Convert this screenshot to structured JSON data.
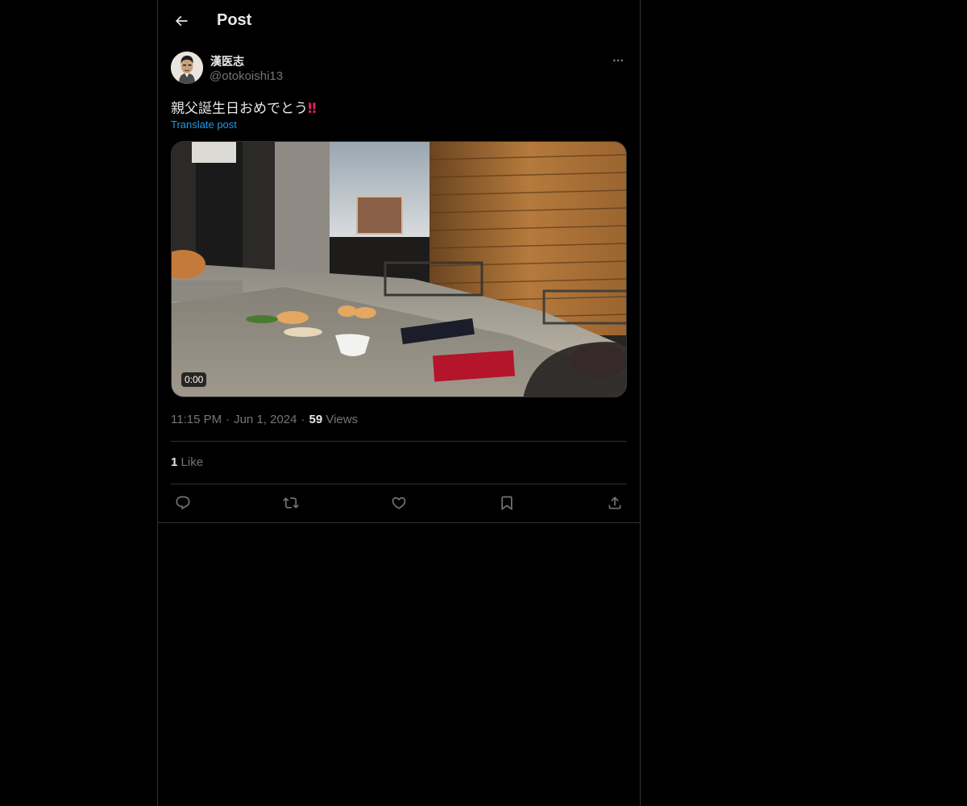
{
  "header": {
    "title": "Post",
    "back_icon": "arrow-left-icon"
  },
  "post": {
    "author_name": "漢医志",
    "author_handle": "@otokoishi13",
    "text": "親父誕生日おめでとう",
    "emoji": "‼",
    "translate_label": "Translate post",
    "video_duration": "0:00",
    "time": "11:15 PM",
    "date": "Jun 1, 2024",
    "views_count": "59",
    "views_label": "Views",
    "likes_count": "1",
    "likes_label": "Like",
    "actions": [
      "reply-icon",
      "repost-icon",
      "like-icon",
      "bookmark-icon",
      "share-icon"
    ]
  },
  "colors": {
    "background": "#000000",
    "text": "#e7e9ea",
    "muted": "#71767b",
    "accent": "#1d9bf0",
    "border": "#2f3336"
  }
}
